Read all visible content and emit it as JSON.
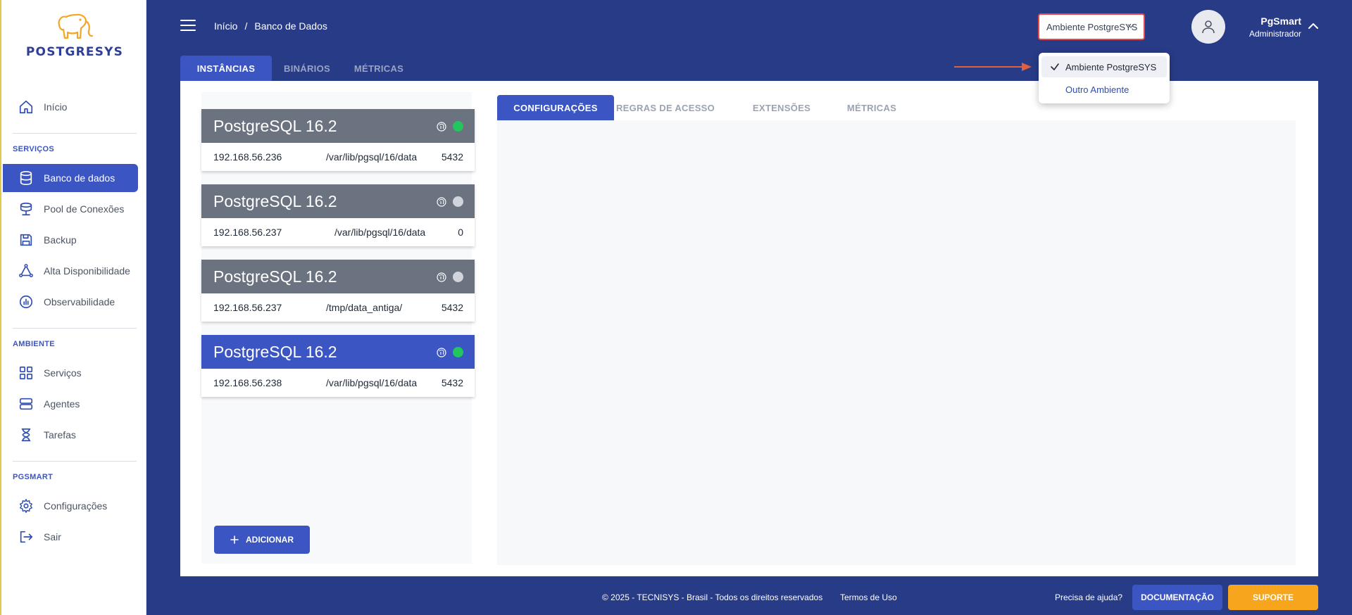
{
  "sidebar": {
    "logo_text": "POSTGRESYS",
    "home": {
      "label": "Início",
      "icon": "home-icon"
    },
    "sections": [
      {
        "title": "SERVIÇOS",
        "items": [
          {
            "label": "Banco de dados",
            "icon": "database-icon",
            "active": true
          },
          {
            "label": "Pool de Conexões",
            "icon": "pool-icon"
          },
          {
            "label": "Backup",
            "icon": "save-icon"
          },
          {
            "label": "Alta Disponibilidade",
            "icon": "triangle-nodes-icon"
          },
          {
            "label": "Observabilidade",
            "icon": "chart-circle-icon"
          }
        ]
      },
      {
        "title": "AMBIENTE",
        "items": [
          {
            "label": "Serviços",
            "icon": "grid-icon"
          },
          {
            "label": "Agentes",
            "icon": "server-icon"
          },
          {
            "label": "Tarefas",
            "icon": "hourglass-icon"
          }
        ]
      },
      {
        "title": "PGSMART",
        "items": [
          {
            "label": "Configurações",
            "icon": "gear-icon"
          },
          {
            "label": "Sair",
            "icon": "logout-icon"
          }
        ]
      }
    ]
  },
  "header": {
    "breadcrumb": {
      "home": "Início",
      "separator": "/",
      "current": "Banco de Dados"
    },
    "environment": {
      "selected": "Ambiente PostgreSYS",
      "options": [
        "Ambiente PostgreSYS",
        "Outro Ambiente"
      ]
    },
    "user": {
      "name": "PgSmart",
      "role": "Administrador"
    }
  },
  "tabs": {
    "main": [
      {
        "label": "INSTÂNCIAS",
        "active": true
      },
      {
        "label": "BINÁRIOS",
        "active": false
      },
      {
        "label": "MÉTRICAS",
        "active": false
      }
    ],
    "detail": [
      {
        "label": "CONFIGURAÇÕES",
        "active": true
      },
      {
        "label": "REGRAS DE ACESSO",
        "active": false
      },
      {
        "label": "EXTENSÕES",
        "active": false
      },
      {
        "label": "MÉTRICAS",
        "active": false
      }
    ]
  },
  "instances": [
    {
      "title": "PostgreSQL 16.2",
      "ip": "192.168.56.236",
      "path": "/var/lib/pgsql/16/data",
      "port": "5432",
      "status": "online",
      "selected": false
    },
    {
      "title": "PostgreSQL 16.2",
      "ip": "192.168.56.237",
      "path": "/var/lib/pgsql/16/data",
      "port": "0",
      "status": "offline",
      "selected": false
    },
    {
      "title": "PostgreSQL 16.2",
      "ip": "192.168.56.237",
      "path": "/tmp/data_antiga/",
      "port": "5432",
      "status": "offline",
      "selected": false
    },
    {
      "title": "PostgreSQL 16.2",
      "ip": "192.168.56.238",
      "path": "/var/lib/pgsql/16/data",
      "port": "5432",
      "status": "online",
      "selected": true
    }
  ],
  "add_button": "ADICIONAR",
  "footer": {
    "copyright": "© 2025 - TECNISYS - Brasil - Todos os direitos reservados",
    "terms": "Termos de Uso",
    "help": "Precisa de ajuda?",
    "documentation": "DOCUMENTAÇÃO",
    "support": "SUPORTE"
  },
  "colors": {
    "primary": "#3b55c2",
    "header_bg": "#283b86",
    "online": "#22c55e",
    "offline": "#d1d5db",
    "support": "#f7a51c",
    "highlight_border": "#e5484d"
  }
}
